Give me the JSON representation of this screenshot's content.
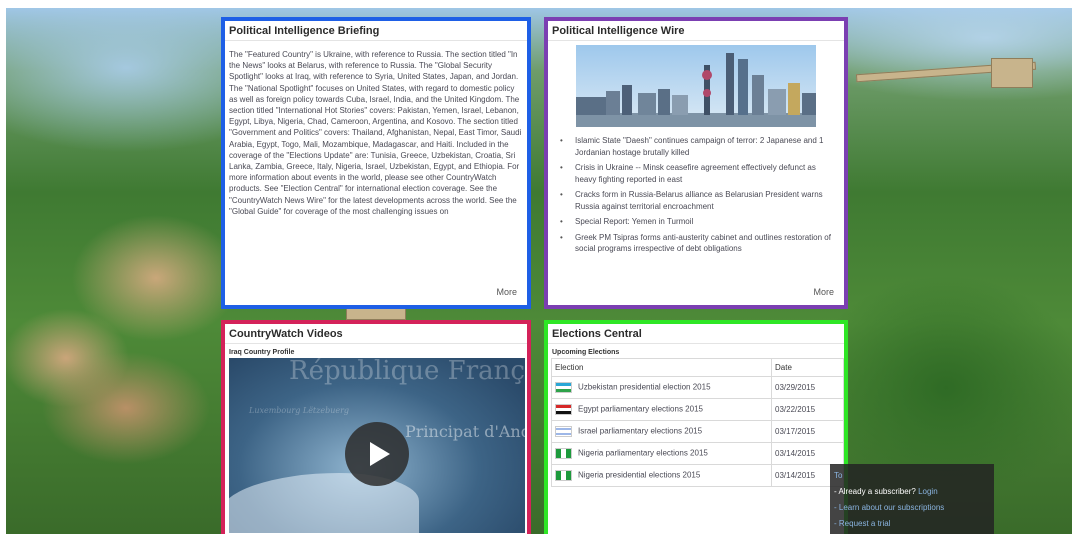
{
  "briefing": {
    "title": "Political Intelligence Briefing",
    "text": "The \"Featured Country\" is Ukraine, with reference to Russia.  The section titled \"In the News\" looks at Belarus, with reference to Russia. The \"Global Security Spotlight\" looks at Iraq, with reference to Syria, United States, Japan, and Jordan. The \"National Spotlight\" focuses on United States, with regard to domestic policy as well as foreign policy towards Cuba, Israel, India, and the United Kingdom. The section titled \"International Hot Stories\" covers: Pakistan, Yemen, Israel, Lebanon, Egypt,  Libya, Nigeria,  Chad, Cameroon, Argentina, and Kosovo. The section titled \"Government and Politics\" covers: Thailand, Afghanistan, Nepal, East Timor, Saudi Arabia, Egypt, Togo, Mali, Mozambique, Madagascar, and Haiti. Included in the coverage of the \"Elections Update\" are: Tunisia, Greece, Uzbekistan, Croatia, Sri Lanka, Zambia, Greece, Italy, Nigeria, Israel, Uzbekistan, Egypt, and Ethiopia. For more information about events in the world, please see other CountryWatch products. See \"Election Central\" for international election coverage. See the \"CountryWatch News Wire\" for the latest developments across the world. See the \"Global Guide\" for coverage of the most challenging issues on",
    "more": "More"
  },
  "wire": {
    "title": "Political Intelligence Wire",
    "image_icon": "city-skyline-image",
    "items": [
      "Islamic State \"Daesh\" continues campaign of terror: 2 Japanese and 1 Jordanian hostage brutally killed",
      "Crisis in Ukraine -- Minsk ceasefire agreement effectively defunct as heavy fighting reported in east",
      "Cracks form in Russia-Belarus alliance as Belarusian President warns Russia against territorial encroachment",
      "Special Report: Yemen in Turmoil",
      "Greek PM Tsipras forms anti-austerity cabinet and outlines restoration of social programs irrespective of debt obligations"
    ],
    "more": "More"
  },
  "videos": {
    "title": "CountryWatch Videos",
    "subtitle": "Iraq Country Profile",
    "ghost_top": "République Franç",
    "ghost_mid": "Principat d'Andorra",
    "ghost_small": "Luxembourg Lëtzebuerg"
  },
  "elections": {
    "title": "Elections Central",
    "subtitle": "Upcoming Elections",
    "col_election": "Election",
    "col_date": "Date",
    "rows": [
      {
        "flag": "uz",
        "name": "Uzbekistan presidential election 2015",
        "date": "03/29/2015"
      },
      {
        "flag": "eg",
        "name": "Egypt parliamentary elections 2015",
        "date": "03/22/2015"
      },
      {
        "flag": "il",
        "name": "Israel parliamentary elections 2015",
        "date": "03/17/2015"
      },
      {
        "flag": "ng",
        "name": "Nigeria parliamentary elections 2015",
        "date": "03/14/2015"
      },
      {
        "flag": "ng",
        "name": "Nigeria presidential elections 2015",
        "date": "03/14/2015"
      }
    ]
  },
  "subscriber": {
    "top": "To",
    "line1_prefix": "- Already a subscriber?",
    "login": "Login",
    "line2": "- Learn about our subscriptions",
    "line3": "- Request a trial"
  }
}
